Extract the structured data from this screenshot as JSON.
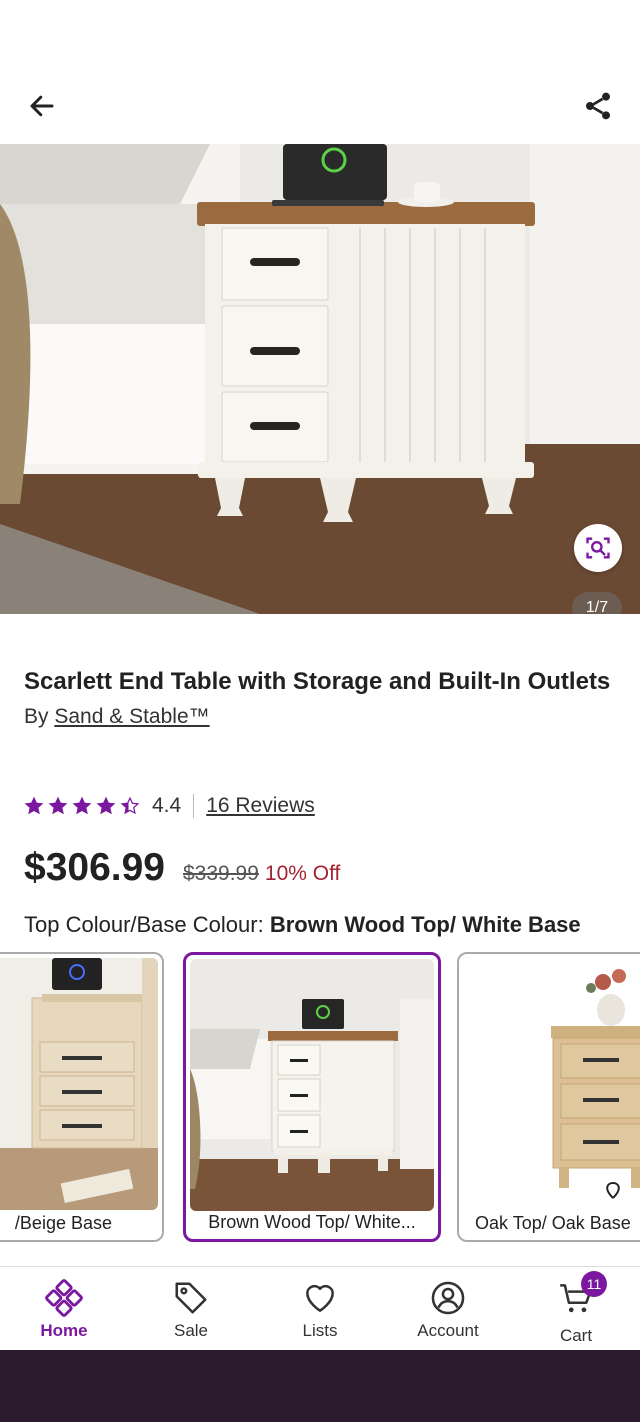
{
  "header": {
    "back_icon": "arrow-left-icon",
    "share_icon": "share-icon"
  },
  "gallery": {
    "counter": "1/7",
    "visual_search_icon": "visual-search-icon"
  },
  "product": {
    "title": "Scarlett End Table with Storage and Built-In Outlets",
    "by_prefix": "By",
    "brand": "Sand & Stable™",
    "rating": "4.4",
    "rating_value": 4.4,
    "reviews": "16 Reviews",
    "price": "$306.99",
    "was_price": "$339.99",
    "discount": "10% Off",
    "option_name": "Top Colour/Base Colour:",
    "option_value": "Brown Wood Top/ White Base"
  },
  "swatches": [
    {
      "label": "/Beige Base",
      "selected": false
    },
    {
      "label": "Brown Wood Top/ White...",
      "selected": true
    },
    {
      "label": "Oak Top/ Oak Base",
      "selected": false
    }
  ],
  "nav": {
    "items": [
      {
        "label": "Home",
        "icon": "home-icon",
        "active": true
      },
      {
        "label": "Sale",
        "icon": "tag-icon",
        "active": false
      },
      {
        "label": "Lists",
        "icon": "heart-icon",
        "active": false
      },
      {
        "label": "Account",
        "icon": "account-icon",
        "active": false
      },
      {
        "label": "Cart",
        "icon": "cart-icon",
        "active": false
      }
    ],
    "cart_count": "11"
  },
  "colors": {
    "brand_purple": "#7b189f",
    "sale_red": "#a42332"
  }
}
